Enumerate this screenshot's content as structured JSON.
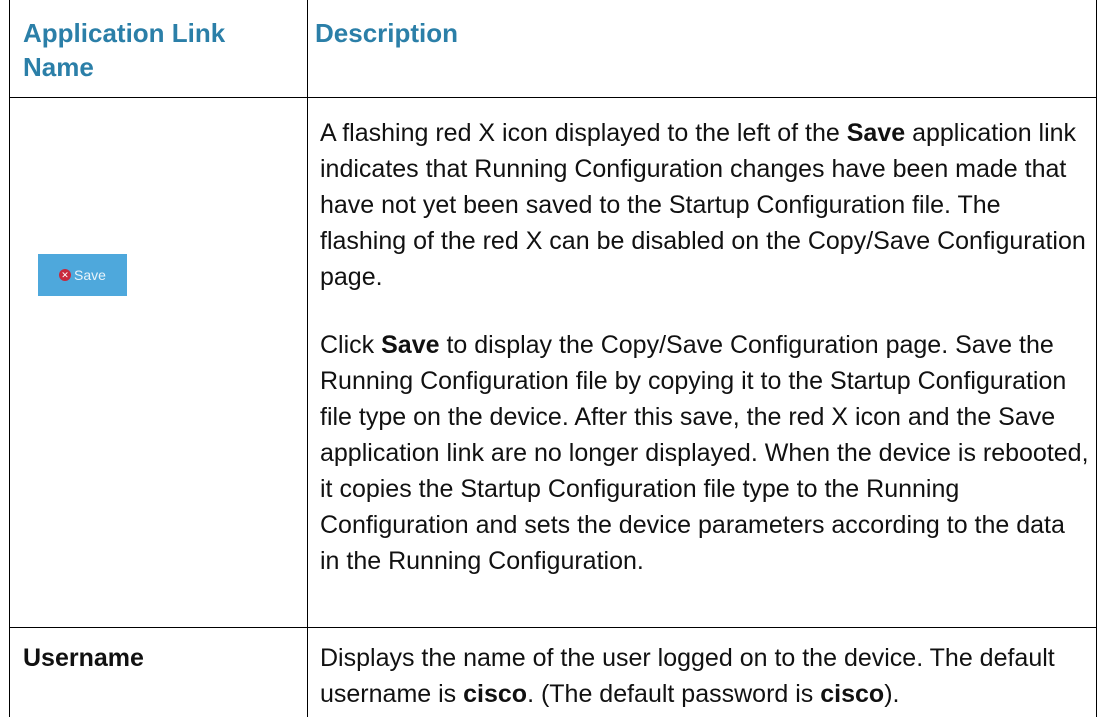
{
  "table": {
    "headers": {
      "name": "Application Link Name",
      "description": "Description"
    },
    "rows": [
      {
        "name_image": {
          "icon": "red-x-icon",
          "label": "Save"
        },
        "description": {
          "p1": {
            "before": "A flashing red X icon displayed to the left of the ",
            "bold": "Save",
            "after": " application link indicates that Running Configuration changes have been made that have not yet been saved to the Startup Configuration file. The flashing of the red X can be disabled on the Copy/Save Configuration page."
          },
          "p2": {
            "before": "Click ",
            "bold": "Save",
            "after": " to display the Copy/Save Configuration page. Save the Running Configuration file by copying it to the Startup Configuration file type on the device. After this save, the red X icon and the Save application link are no longer displayed. When the device is rebooted, it copies the Startup Configuration file type to the Running Configuration and sets the device parameters according to the data in the Running Configuration."
          }
        }
      },
      {
        "name": "Username",
        "description": {
          "before": "Displays the name of the user logged on to the device. The default username is ",
          "bold1": "cisco",
          "middle": ". (The default password is ",
          "bold2": "cisco",
          "after": ")."
        }
      }
    ]
  },
  "colors": {
    "header_text": "#2b7fa8",
    "save_button_bg": "#4ea8dc",
    "red_x": "#c8283c"
  }
}
